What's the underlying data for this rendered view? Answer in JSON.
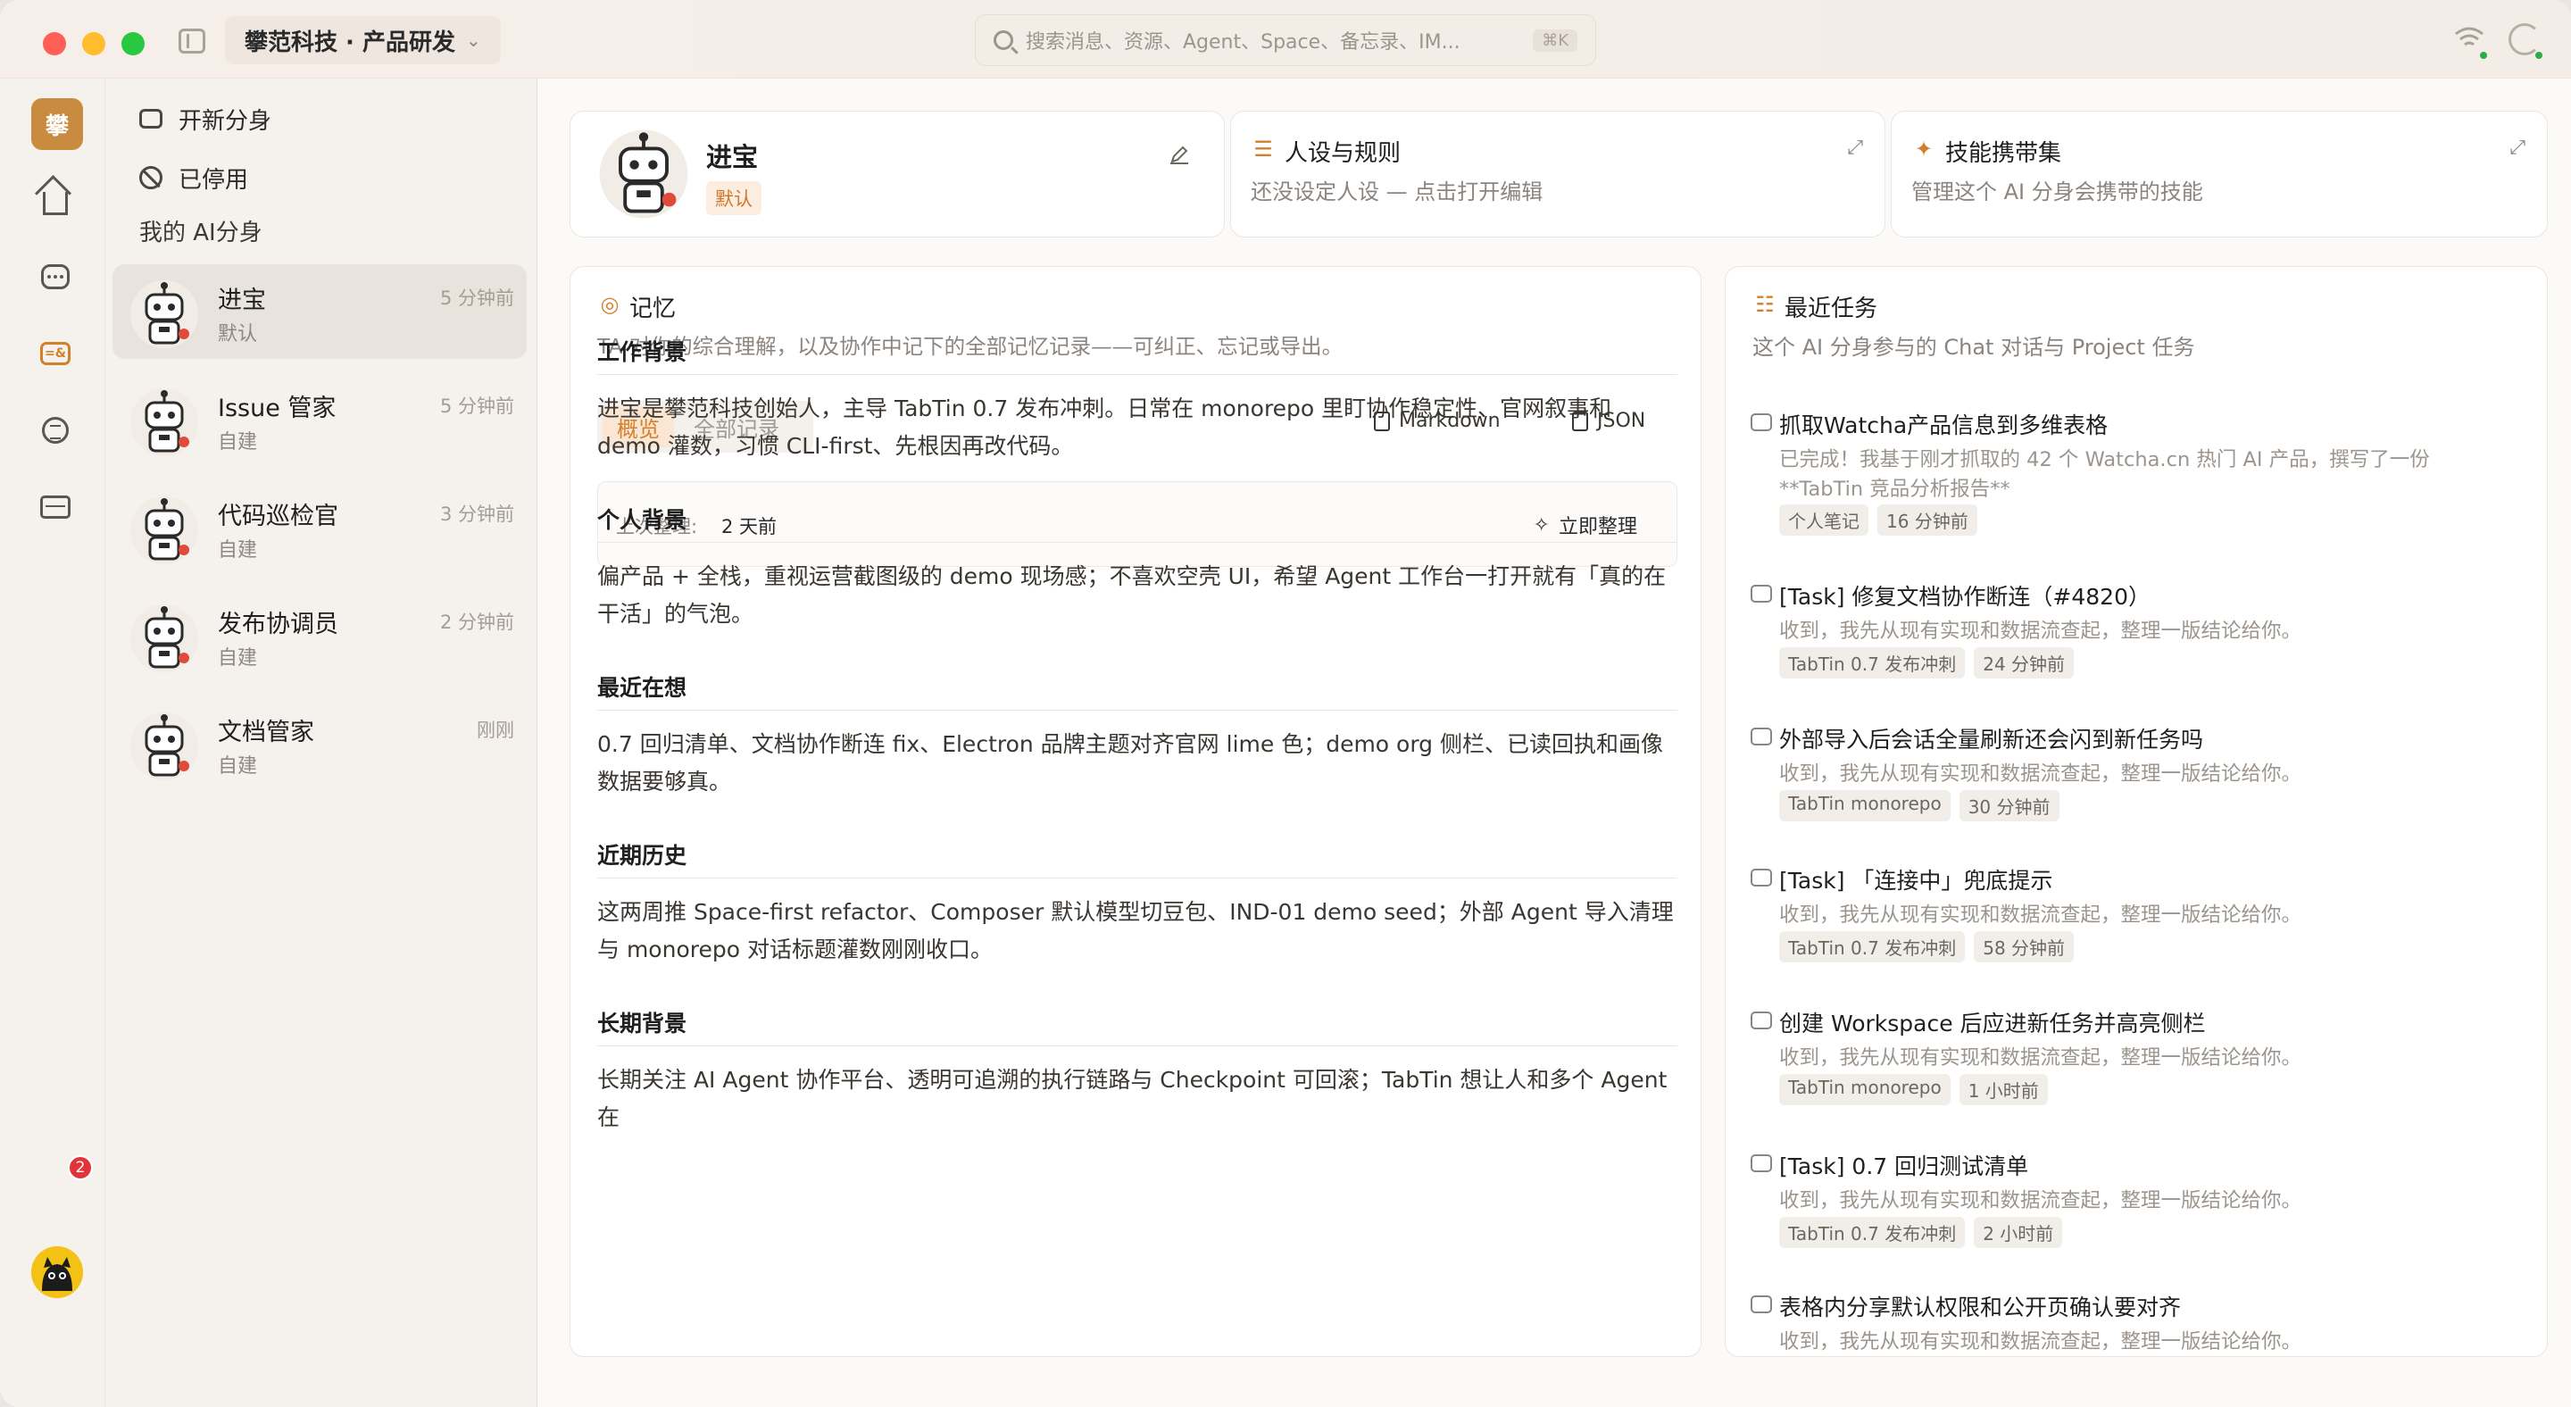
{
  "titlebar": {
    "org_name": "攀范科技 · 产品研发",
    "search_placeholder": "搜索消息、资源、Agent、Space、备忘录、IM...",
    "search_shortcut": "⌘K"
  },
  "rail": {
    "workspace_initial": "攀",
    "inbox_badge": "2",
    "icons": [
      "home-icon",
      "chat-icon",
      "agent-icon",
      "list-icon",
      "folder-icon",
      "inbox-icon"
    ]
  },
  "sidebar": {
    "actions": [
      {
        "label": "开新分身",
        "icon": "bot-icon"
      },
      {
        "label": "已停用",
        "icon": "ban-icon"
      }
    ],
    "section_title": "我的 AI分身",
    "agents": [
      {
        "name": "进宝",
        "sub": "默认",
        "time": "5 分钟前",
        "active": true
      },
      {
        "name": "Issue 管家",
        "sub": "自建",
        "time": "5 分钟前"
      },
      {
        "name": "代码巡检官",
        "sub": "自建",
        "time": "3 分钟前"
      },
      {
        "name": "发布协调员",
        "sub": "自建",
        "time": "2 分钟前"
      },
      {
        "name": "文档管家",
        "sub": "自建",
        "time": "刚刚"
      }
    ]
  },
  "profile": {
    "name": "进宝",
    "tag": "默认"
  },
  "persona": {
    "title": "人设与规则",
    "subtitle": "还没设定人设 — 点击打开编辑"
  },
  "skills": {
    "title": "技能携带集",
    "subtitle": "管理这个 AI 分身会携带的技能"
  },
  "memory": {
    "title": "记忆",
    "subtitle": "TA 对你的综合理解，以及协作中记下的全部记忆记录——可纠正、忘记或导出。",
    "tabs": [
      "概览",
      "全部记录"
    ],
    "export_markdown": "Markdown",
    "export_json": "JSON",
    "last_label": "上次整理:",
    "last_value": "2 天前",
    "tidy_label": "立即整理",
    "sections": [
      {
        "heading": "工作背景",
        "text": "进宝是攀范科技创始人，主导 TabTin 0.7 发布冲刺。日常在 monorepo 里盯协作稳定性、官网叙事和 demo 灌数，习惯 CLI-first、先根因再改代码。"
      },
      {
        "heading": "个人背景",
        "text": "偏产品 + 全栈，重视运营截图级的 demo 现场感；不喜欢空壳 UI，希望 Agent 工作台一打开就有「真的在干活」的气泡。"
      },
      {
        "heading": "最近在想",
        "text": "0.7 回归清单、文档协作断连 fix、Electron 品牌主题对齐官网 lime 色；demo org 侧栏、已读回执和画像数据要够真。"
      },
      {
        "heading": "近期历史",
        "text": "这两周推 Space-first refactor、Composer 默认模型切豆包、IND-01 demo seed；外部 Agent 导入清理与 monorepo 对话标题灌数刚刚收口。"
      },
      {
        "heading": "长期背景",
        "text": "长期关注 AI Agent 协作平台、透明可追溯的执行链路与 Checkpoint 可回滚；TabTin 想让人和多个 Agent 在"
      }
    ]
  },
  "tasks": {
    "title": "最近任务",
    "subtitle": "这个 AI 分身参与的 Chat 对话与 Project 任务",
    "items": [
      {
        "name": "抓取Watcha产品信息到多维表格",
        "desc": "已完成！我基于刚才抓取的 42 个 Watcha.cn 热门 AI 产品，撰写了一份 **TabTin 竞品分析报告**",
        "chips": [
          "个人笔记",
          "16 分钟前"
        ]
      },
      {
        "name": "[Task] 修复文档协作断连（#4820）",
        "desc": "收到，我先从现有实现和数据流查起，整理一版结论给你。",
        "chips": [
          "TabTin 0.7 发布冲刺",
          "24 分钟前"
        ]
      },
      {
        "name": "外部导入后会话全量刷新还会闪到新任务吗",
        "desc": "收到，我先从现有实现和数据流查起，整理一版结论给你。",
        "chips": [
          "TabTin monorepo",
          "30 分钟前"
        ]
      },
      {
        "name": "[Task] 「连接中」兜底提示",
        "desc": "收到，我先从现有实现和数据流查起，整理一版结论给你。",
        "chips": [
          "TabTin 0.7 发布冲刺",
          "58 分钟前"
        ]
      },
      {
        "name": "创建 Workspace 后应进新任务并高亮侧栏",
        "desc": "收到，我先从现有实现和数据流查起，整理一版结论给你。",
        "chips": [
          "TabTin monorepo",
          "1 小时前"
        ]
      },
      {
        "name": "[Task] 0.7 回归测试清单",
        "desc": "收到，我先从现有实现和数据流查起，整理一版结论给你。",
        "chips": [
          "TabTin 0.7 发布冲刺",
          "2 小时前"
        ]
      },
      {
        "name": "表格内分享默认权限和公开页确认要对齐",
        "desc": "收到，我先从现有实现和数据流查起，整理一版结论给你。",
        "chips": []
      }
    ]
  }
}
